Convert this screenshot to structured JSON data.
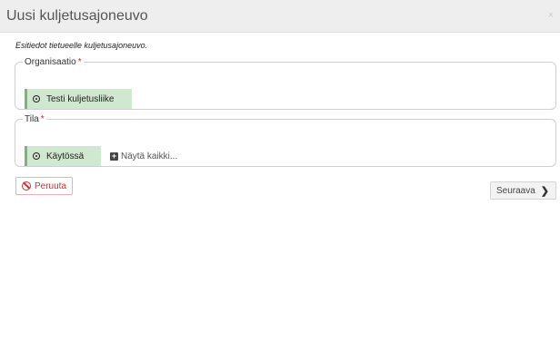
{
  "dialog": {
    "title": "Uusi kuljetusajoneuvo",
    "close_label": "×",
    "description": "Esitiedot tietueelle kuljetusajoneuvo."
  },
  "organisaatio": {
    "legend": "Organisaatio",
    "required_mark": "*",
    "selected": "Testi kuljetusliike"
  },
  "tila": {
    "legend": "Tila",
    "required_mark": "*",
    "selected": "Käytössä",
    "show_all": "Näytä kaikki..."
  },
  "actions": {
    "cancel": "Peruuta",
    "next": "Seuraava"
  },
  "icons": {
    "radio": "radio-selected-icon",
    "plus": "plus-square-icon",
    "cancel": "ban-icon",
    "next": "chevron-right-icon"
  }
}
